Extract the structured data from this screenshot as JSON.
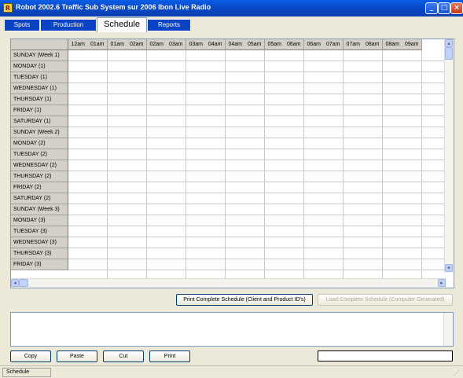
{
  "window": {
    "title": "Robot 2002.6 Traffic Sub System sur 2006 Ibon Live Radio"
  },
  "tabs": [
    "Spots",
    "Production",
    "Schedule",
    "Reports"
  ],
  "active_tab": "Schedule",
  "grid": {
    "columns": [
      [
        "12am",
        "01am"
      ],
      [
        "01am",
        "02am"
      ],
      [
        "02am",
        "03am"
      ],
      [
        "03am",
        "04am"
      ],
      [
        "04am",
        "05am"
      ],
      [
        "05am",
        "06am"
      ],
      [
        "06am",
        "07am"
      ],
      [
        "07am",
        "08am"
      ],
      [
        "08am",
        "09am"
      ]
    ],
    "rows": [
      "SUNDAY (Week 1)",
      "MONDAY (1)",
      "TUESDAY (1)",
      "WEDNESDAY (1)",
      "THURSDAY (1)",
      "FRIDAY (1)",
      "SATURDAY (1)",
      "SUNDAY (Week 2)",
      "MONDAY (2)",
      "TUESDAY (2)",
      "WEDNESDAY (2)",
      "THURSDAY (2)",
      "FRIDAY (2)",
      "SATURDAY (2)",
      "SUNDAY (Week 3)",
      "MONDAY (3)",
      "TUESDAY (3)",
      "WEDNESDAY (3)",
      "THURSDAY (3)",
      "FRIDAY (3)"
    ]
  },
  "buttons": {
    "print_schedule": "Print Complete Schedule (Client and Product ID's)",
    "load_schedule": "Load Complete Schedule (Computer Generated)",
    "copy": "Copy",
    "paste": "Paste",
    "cut": "Cut",
    "print": "Print"
  },
  "status": {
    "panel": "Schedule"
  }
}
